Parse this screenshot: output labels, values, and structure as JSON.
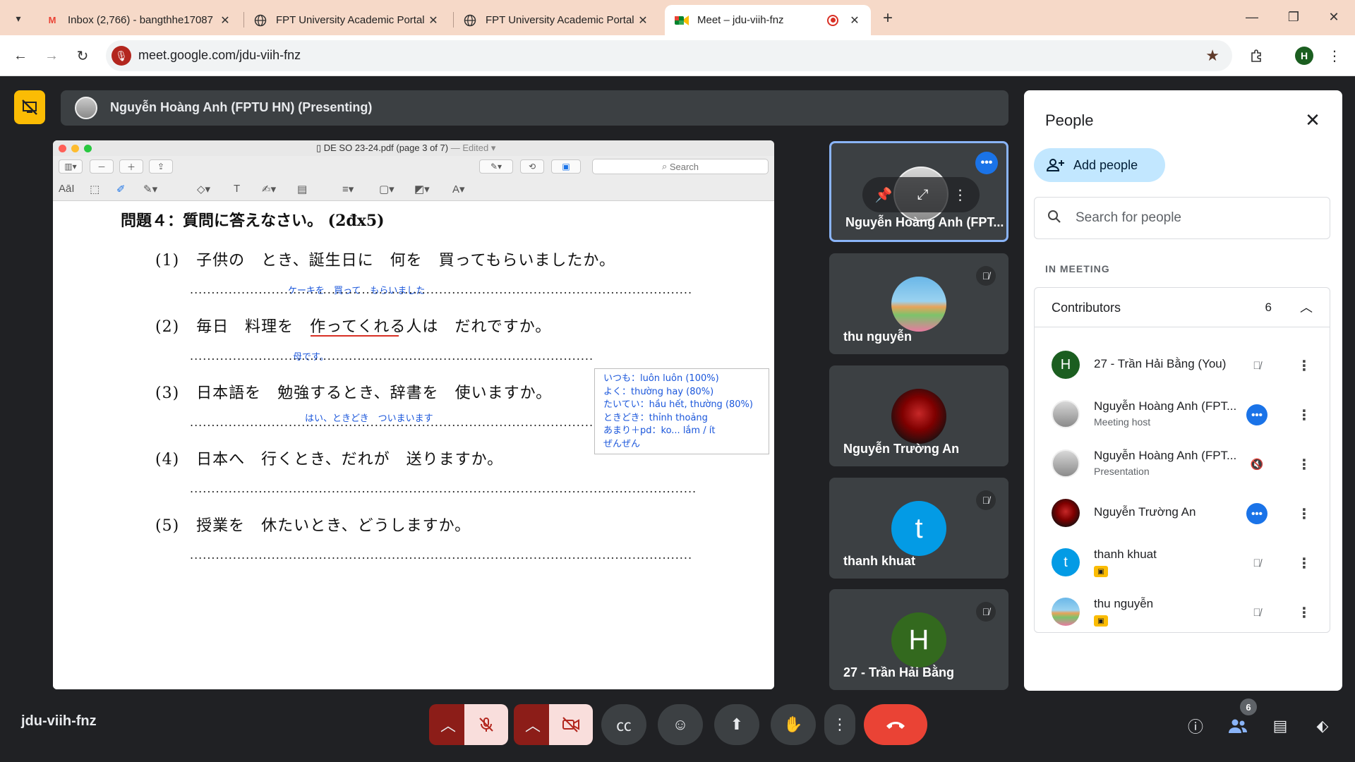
{
  "browser": {
    "tabs": [
      {
        "title": "Inbox (2,766) - bangthhe17087",
        "favicon": "gmail-icon"
      },
      {
        "title": "FPT University Academic Portal",
        "favicon": "globe-icon"
      },
      {
        "title": "FPT University Academic Portal",
        "favicon": "globe-icon"
      },
      {
        "title": "Meet – jdu-viih-fnz",
        "favicon": "meet-icon"
      }
    ],
    "url": "meet.google.com/jdu-viih-fnz",
    "profile_initial": "H"
  },
  "presenting": {
    "label": "Nguyễn Hoàng Anh (FPTU HN) (Presenting)"
  },
  "shared_screen": {
    "doc_title": "DE SO 23-24.pdf (page 3 of 7)",
    "edited": "— Edited",
    "search_placeholder": "Search",
    "heading": "問題４：質問に答えなさい。 (2đx5)",
    "questions": [
      {
        "num": "(1)",
        "text": "子供の　とき、誕生日に　何を　買ってもらいましたか。",
        "answer": "ケーキを　買って　もらいました"
      },
      {
        "num": "(2)",
        "text": "毎日　料理を　作ってくれる人は　だれですか。",
        "answer": "母です。"
      },
      {
        "num": "(3)",
        "text": "日本語を　勉強するとき、辞書を　使いますか。",
        "answer": "はい、ときどき　ついまいます"
      },
      {
        "num": "(4)",
        "text": "日本へ　行くとき、だれが　送りますか。",
        "answer": ""
      },
      {
        "num": "(5)",
        "text": "授業を　休たいとき、どうしますか。",
        "answer": ""
      }
    ],
    "note_lines": [
      "いつも：luôn luôn (100%)",
      "よく：thường hay (80%)",
      "たいてい：hầu hết, thường (80%)",
      "ときどき：thỉnh thoảng",
      "あまり＋pd：ko... lắm / ít",
      "ぜんぜん"
    ]
  },
  "tiles": [
    {
      "name": "Nguyễn Hoàng Anh (FPT...",
      "state": "speaking"
    },
    {
      "name": "thu nguyễn",
      "state": "muted"
    },
    {
      "name": "Nguyễn Trường An",
      "state": "none"
    },
    {
      "name": "thanh khuat",
      "state": "muted",
      "initial": "t"
    },
    {
      "name": "27 - Trần Hải Bằng",
      "state": "muted",
      "initial": "H"
    }
  ],
  "people_panel": {
    "title": "People",
    "add_people": "Add people",
    "search_placeholder": "Search for people",
    "section": "IN MEETING",
    "group_label": "Contributors",
    "group_count": "6",
    "people": [
      {
        "name": "27 - Trần Hải Bằng (You)",
        "sub": "",
        "initial": "H",
        "state": "muted"
      },
      {
        "name": "Nguyễn Hoàng Anh (FPT...",
        "sub": "Meeting host",
        "state": "speaking"
      },
      {
        "name": "Nguyễn Hoàng Anh (FPT...",
        "sub": "Presentation",
        "state": "audio-off"
      },
      {
        "name": "Nguyễn Trường An",
        "sub": "",
        "state": "speaking"
      },
      {
        "name": "thanh khuat",
        "sub": "",
        "initial": "t",
        "state": "muted"
      },
      {
        "name": "thu nguyễn",
        "sub": "",
        "state": "muted"
      }
    ]
  },
  "meeting": {
    "code": "jdu-viih-fnz",
    "people_count": "6"
  },
  "colors": {
    "tab_strip": "#f6d9c8",
    "meet_bg": "#202124",
    "tile_bg": "#3c4043",
    "accent_blue": "#1a73e8",
    "end_call": "#ea4335",
    "present_yellow": "#fbbc04"
  }
}
